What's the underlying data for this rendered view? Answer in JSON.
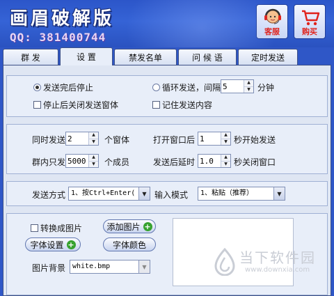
{
  "app": {
    "title": "画眉破解版",
    "qq": "QQ: 381400744"
  },
  "header_buttons": {
    "service_label": "客服",
    "buy_label": "购买"
  },
  "tabs": [
    {
      "label": "群 发",
      "active": false
    },
    {
      "label": "设 置",
      "active": true
    },
    {
      "label": "禁发名单",
      "active": false
    },
    {
      "label": "问 候 语",
      "active": false
    },
    {
      "label": "定时发送",
      "active": false
    }
  ],
  "send_mode": {
    "stop_after_send_label": "发送完后停止",
    "stop_after_send_selected": true,
    "loop_send_label": "循环发送，间隔",
    "loop_send_selected": false,
    "interval_value": "5",
    "interval_unit": "分钟",
    "close_window_label": "停止后关闭发送窗体",
    "close_window_checked": false,
    "remember_content_label": "记住发送内容",
    "remember_content_checked": false
  },
  "timing": {
    "concurrent_label": "同时发送",
    "concurrent_value": "2",
    "concurrent_unit": "个窗体",
    "open_window_label": "打开窗口后",
    "open_window_value": "1",
    "open_window_unit": "秒开始发送",
    "group_limit_label": "群内只发",
    "group_limit_value": "5000",
    "group_limit_unit": "个成员",
    "close_delay_label": "发送后延时",
    "close_delay_value": "1.0",
    "close_delay_unit": "秒关闭窗口"
  },
  "mode": {
    "send_method_label": "发送方式",
    "send_method_value": "1、按Ctrl+Enter(",
    "input_mode_label": "输入模式",
    "input_mode_value": "1、粘贴（推荐）"
  },
  "image": {
    "convert_label": "转换成图片",
    "convert_checked": false,
    "add_image_label": "添加图片",
    "font_settings_label": "字体设置",
    "font_color_label": "字体颜色",
    "background_label": "图片背景",
    "background_value": "white.bmp"
  },
  "watermark": {
    "text": "当下软件园",
    "url": "www.downxia.com"
  },
  "colors": {
    "header_blue": "#2f57c7",
    "panel_bg": "#dfe6f3",
    "plus_green": "#37a22f",
    "header_button_text": "#e0221b"
  }
}
